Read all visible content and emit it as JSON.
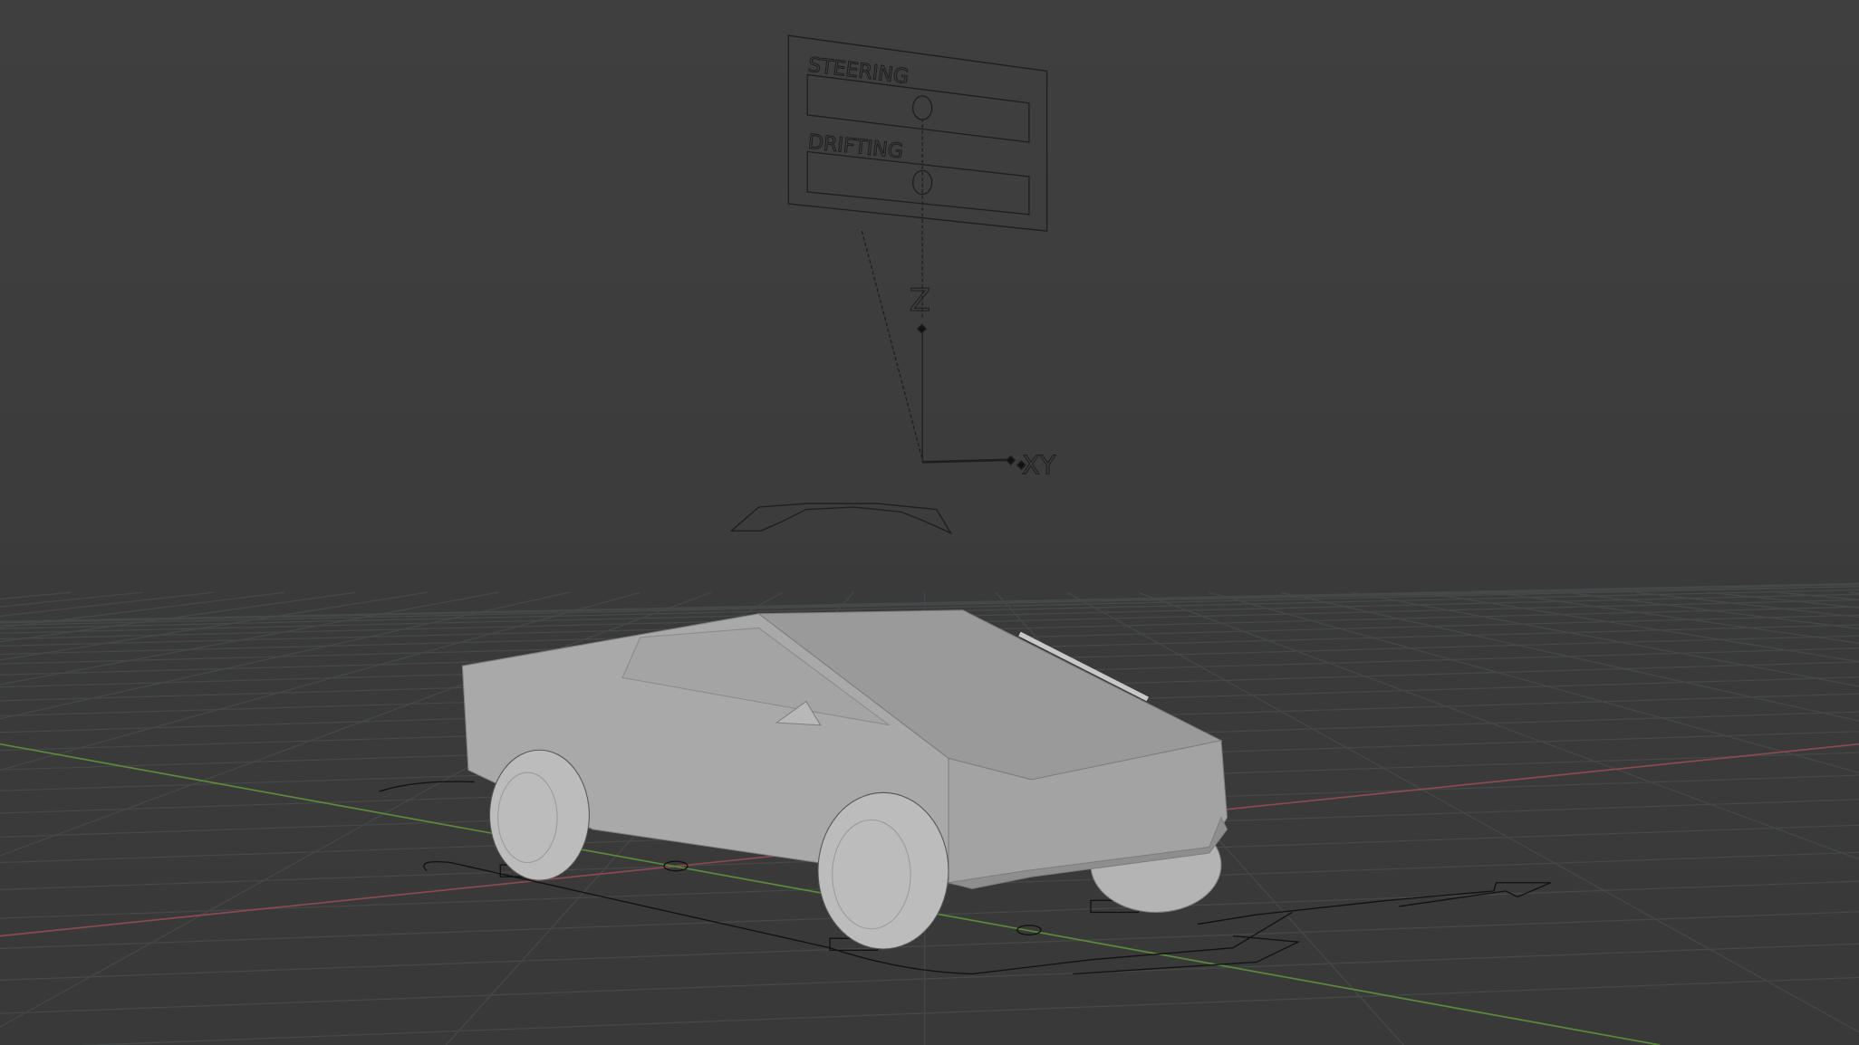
{
  "viewport": {
    "panel_labels": [
      "STEERING",
      "DRIFTING"
    ],
    "axis_labels": {
      "z": "Z",
      "xy": "XY"
    },
    "colors": {
      "background": "#3d3d3d",
      "x_axis": "#8a4a52",
      "y_axis": "#5a8a3a",
      "grid": "#454848",
      "car_body": "#a8a8a8",
      "rig_lines": "#1a1a1a"
    }
  }
}
